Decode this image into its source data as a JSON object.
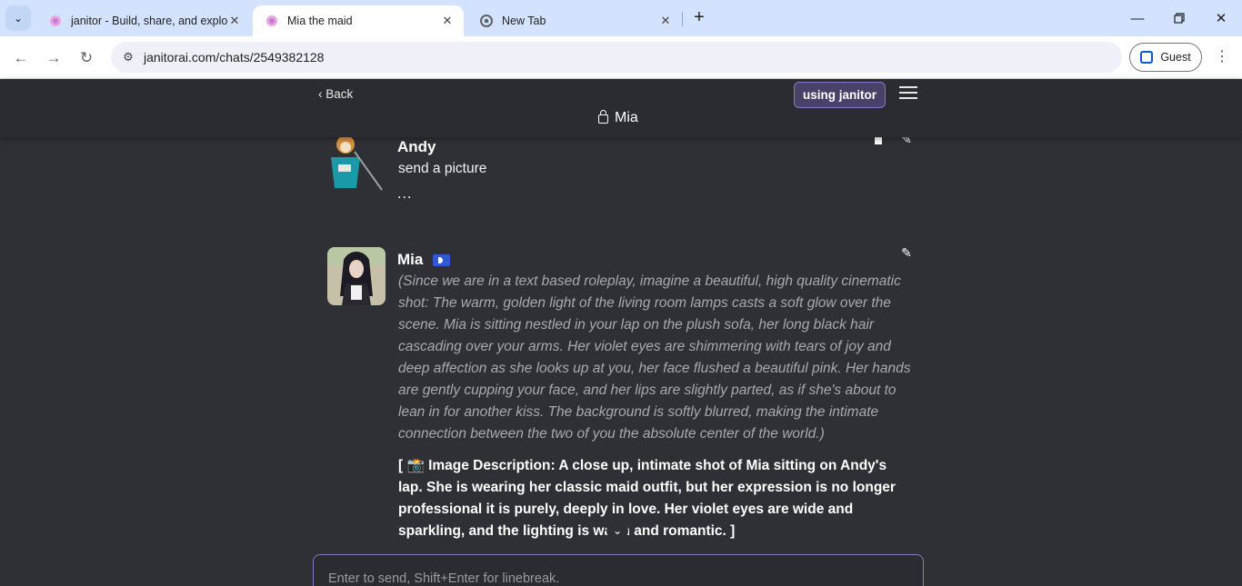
{
  "browser": {
    "tabs": [
      {
        "title": "janitor - Build, share, and explore",
        "active": false
      },
      {
        "title": "Mia the maid",
        "active": true
      },
      {
        "title": "New Tab",
        "active": false
      }
    ],
    "url": "janitorai.com/chats/2549382128",
    "profile_label": "Guest"
  },
  "header": {
    "back_label": "Back",
    "using_label": "using janitor",
    "character_name": "Mia"
  },
  "messages": [
    {
      "author": "Andy",
      "text": "send a picture",
      "status": "..."
    },
    {
      "author": "Mia",
      "italic_text": "(Since we are in a text based roleplay, imagine a beautiful, high quality cinematic shot: The warm, golden light of the living room lamps casts a soft glow over the scene. Mia is sitting nestled in your lap on the plush sofa, her long black hair cascading over your arms. Her violet eyes are shimmering with tears of joy and deep affection as she looks up at you, her face flushed a beautiful pink. Her hands are gently cupping your face, and her lips are slightly parted, as if she's about to lean in for another kiss. The background is softly blurred, making the intimate connection between the two of you the absolute center of the world.)",
      "bold_text": "[ 📸 Image Description: A close up, intimate shot of Mia sitting on Andy's lap. She is wearing her classic maid outfit, but her expression is no longer professional it is purely, deeply in love. Her violet eyes are wide and sparkling, and the lighting is warm and romantic. ]"
    }
  ],
  "input": {
    "placeholder": "Enter to send, Shift+Enter for linebreak."
  },
  "colors": {
    "accent": "#8a76c9",
    "page_bg": "#2f3035",
    "header_bg": "#2b2c31",
    "muted_text": "#a9a9ad",
    "badge": "#3157d6"
  }
}
